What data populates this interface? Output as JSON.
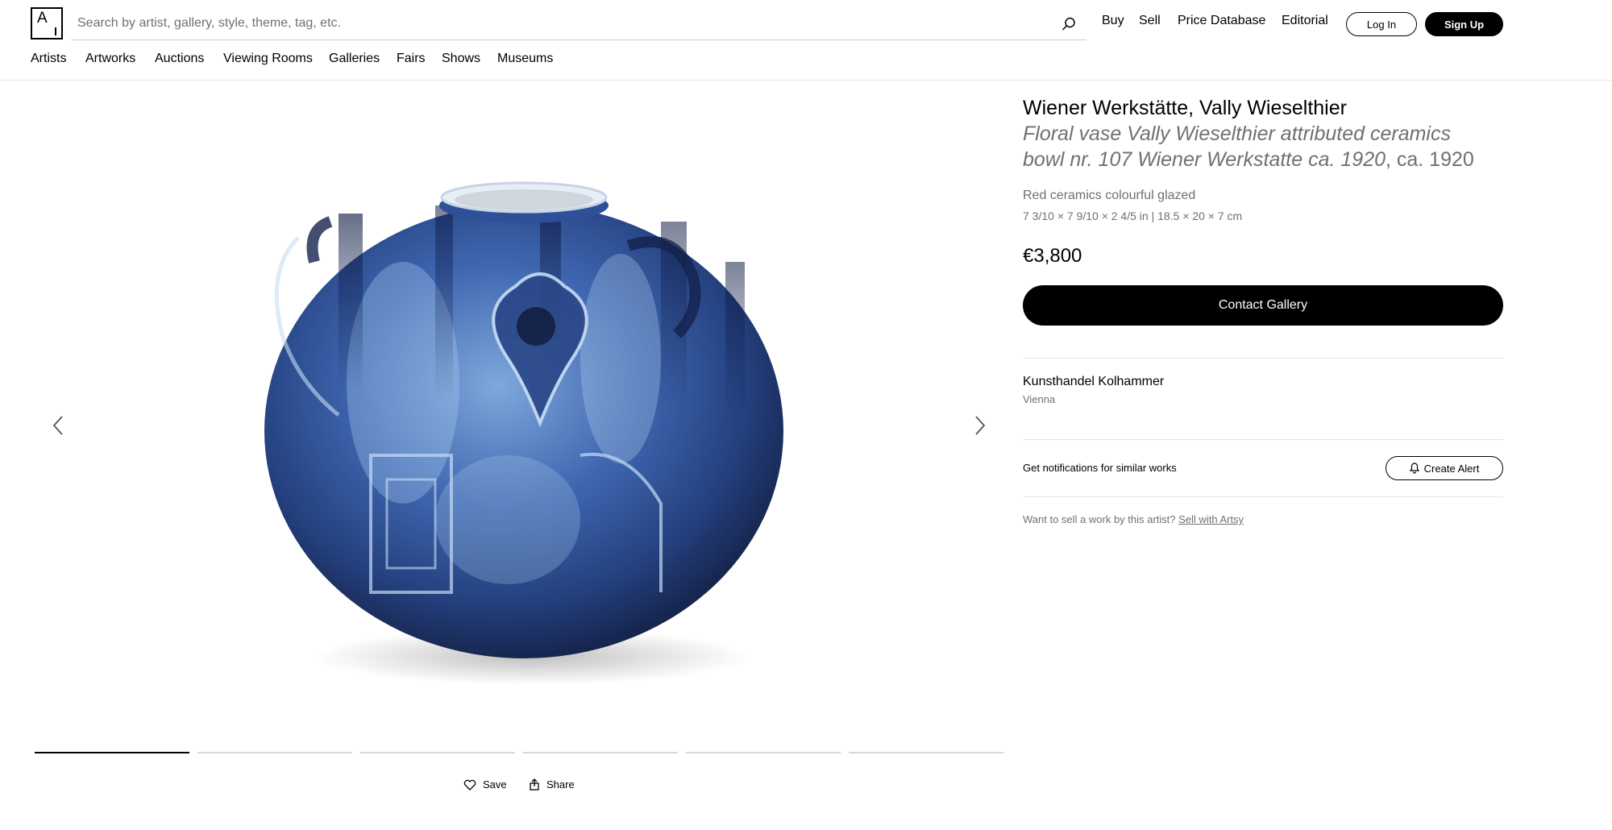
{
  "header": {
    "logo_letter": "A",
    "search_placeholder": "Search by artist, gallery, style, theme, tag, etc.",
    "top_links": [
      "Buy",
      "Sell",
      "Price Database",
      "Editorial"
    ],
    "login_label": "Log In",
    "signup_label": "Sign Up",
    "subnav": [
      "Artists",
      "Artworks",
      "Auctions",
      "Viewing Rooms",
      "Galleries",
      "Fairs",
      "Shows",
      "Museums"
    ]
  },
  "artwork": {
    "artist": "Wiener Werkstätte, Vally Wieselthier",
    "title_line1": "Floral vase Vally Wieselthier attributed ceramics",
    "title_line2": "bowl nr. 107 Wiener Werkstatte ca. 1920",
    "date": ", ca. 1920",
    "medium": "Red ceramics colourful glazed",
    "dimensions": "7 3/10 × 7 9/10 × 2 4/5 in | 18.5 × 20 × 7 cm",
    "price": "€3,800",
    "contact_label": "Contact Gallery"
  },
  "gallery": {
    "name": "Kunsthandel Kolhammer",
    "location": "Vienna"
  },
  "alert": {
    "text": "Get notifications for similar works",
    "button_label": "Create Alert"
  },
  "sell": {
    "text": "Want to sell a work by this artist? ",
    "link": "Sell with Artsy"
  },
  "image_actions": {
    "save_label": "Save",
    "share_label": "Share"
  },
  "image_progress": {
    "total": 6,
    "active_index": 0
  },
  "colors": {
    "primary": "#000000",
    "muted_text": "#707070",
    "vase_dark": "#1c2c5e",
    "vase_mid": "#3e66b0",
    "vase_light": "#9cc4e8"
  }
}
